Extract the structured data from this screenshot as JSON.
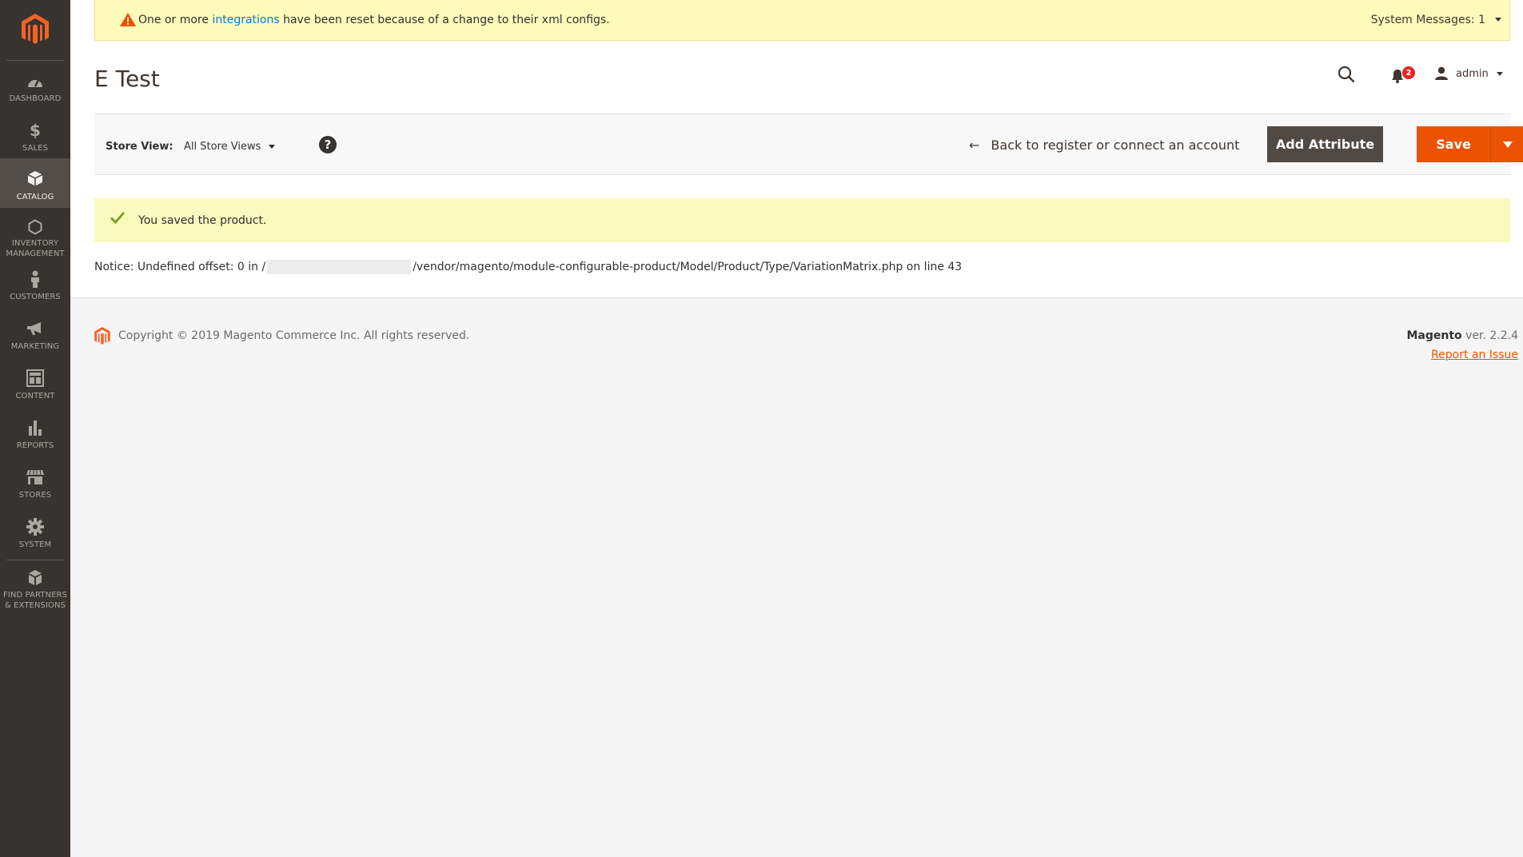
{
  "colors": {
    "sidebar_bg": "#373330",
    "sidebar_active_bg": "#524d49",
    "accent": "#eb5202",
    "message_bg": "#fffbbb",
    "link": "#007bdb"
  },
  "sidebar": {
    "logo_icon": "magento-logo-icon",
    "items": [
      {
        "label": "DASHBOARD",
        "icon": "dashboard-gauge-icon"
      },
      {
        "label": "SALES",
        "icon": "dollar-icon"
      },
      {
        "label": "CATALOG",
        "icon": "box-icon",
        "active": true
      },
      {
        "label": "INVENTORY MANAGEMENT",
        "label_line1": "INVENTORY",
        "label_line2": "MANAGEMENT",
        "icon": "hexagon-icon"
      },
      {
        "label": "CUSTOMERS",
        "icon": "person-icon"
      },
      {
        "label": "MARKETING",
        "icon": "megaphone-icon"
      },
      {
        "label": "CONTENT",
        "icon": "layout-icon"
      },
      {
        "label": "REPORTS",
        "icon": "bar-chart-icon"
      },
      {
        "label": "STORES",
        "icon": "storefront-icon"
      },
      {
        "label": "SYSTEM",
        "icon": "gear-icon"
      },
      {
        "label": "FIND PARTNERS & EXTENSIONS",
        "label_line1": "FIND PARTNERS",
        "label_line2": "& EXTENSIONS",
        "icon": "cubes-icon"
      }
    ]
  },
  "system_message": {
    "text_before": "One or more ",
    "link_text": "integrations",
    "text_after": " have been reset because of a change to their xml configs.",
    "count_label": "System Messages: 1"
  },
  "header": {
    "page_title": "E Test",
    "notification_count": "2",
    "user_name": "admin"
  },
  "toolbar": {
    "store_view_label": "Store View:",
    "store_view_value": "All Store Views",
    "help_symbol": "?",
    "back_label": "Back to register or connect an account",
    "add_attribute_label": "Add Attribute",
    "save_label": "Save"
  },
  "messages": {
    "success": "You saved the product.",
    "notice_before": "Notice: Undefined offset: 0 in /",
    "notice_after": "/vendor/magento/module-configurable-product/Model/Product/Type/VariationMatrix.php on line 43"
  },
  "footer": {
    "copyright": "Copyright © 2019 Magento Commerce Inc. All rights reserved.",
    "brand": "Magento",
    "version": " ver. 2.2.4",
    "report_link": "Report an Issue"
  }
}
